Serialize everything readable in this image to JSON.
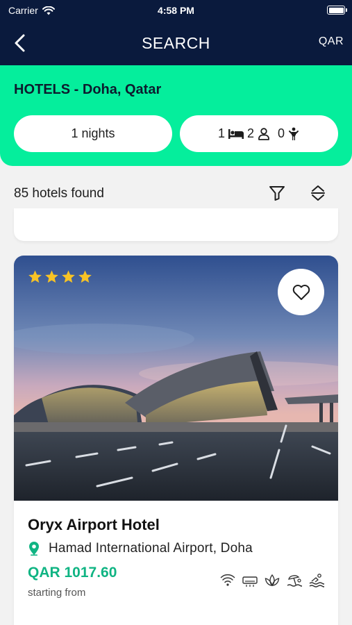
{
  "status_bar": {
    "carrier": "Carrier",
    "time": "4:58 PM"
  },
  "nav": {
    "title": "SEARCH",
    "currency": "QAR"
  },
  "header": {
    "title": "HOTELS - Doha, Qatar",
    "nights_label": "1 nights",
    "rooms": "1",
    "adults": "2",
    "children": "0"
  },
  "results": {
    "count_label": "85 hotels found"
  },
  "hotel": {
    "stars": 4,
    "name": "Oryx Airport Hotel",
    "location": "Hamad International Airport, Doha",
    "price": "QAR 1017.60",
    "price_note": "starting from",
    "amenities": [
      "wifi-icon",
      "air-conditioner-icon",
      "spa-icon",
      "beach-icon",
      "pool-icon"
    ]
  },
  "colors": {
    "navy": "#0a1a3d",
    "green": "#05ee9c",
    "price": "#10b483",
    "star": "#f7c325"
  }
}
